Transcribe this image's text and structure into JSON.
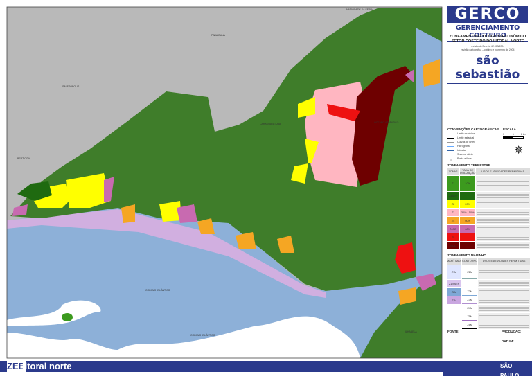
{
  "header": {
    "logo": "GERCO",
    "subtitle": "GERENCIAMENTO COSTEIRO",
    "title1": "ZONEAMENTO ECOLÓGICO-ECONÔMICO",
    "title2": "SETOR COSTEIRO DO LITORAL NORTE",
    "note1": "revisão do Decreto 62.913/2004",
    "note2": "revisão cartográfica – outubro e novembro de 2004",
    "city": "são sebastião"
  },
  "conventions": {
    "title": "CONVENÇÕES CARTOGRÁFICAS",
    "items": [
      "Limite municipal",
      "Limite estadual",
      "Curvas de nível",
      "Hidrografia",
      "Isóbata",
      "Sistema viário",
      "Ponta e ilhas"
    ]
  },
  "scale": {
    "title": "ESCALA",
    "ticks": [
      "0",
      "1",
      "2 km"
    ]
  },
  "terrestrial": {
    "title": "ZONEAMENTO TERRESTRE",
    "headers": [
      "ZONAS",
      "TAXA DE UTILIZAÇÃO",
      "USOS E ATIVIDADES PERMITIDAS"
    ],
    "rows": [
      {
        "zone": "Z1",
        "rate": "10%",
        "color": "#3c9a1e"
      },
      {
        "zone": "Z1AEP",
        "rate": "",
        "color": "#1f6a10"
      },
      {
        "zone": "Z2",
        "rate": "20%",
        "color": "#ffff00"
      },
      {
        "zone": "Z3",
        "rate": "30% - 50%",
        "color": "#ffb6c1"
      },
      {
        "zone": "Z4",
        "rate": "60%",
        "color": "#f5a623"
      },
      {
        "zone": "Z4OD",
        "rate": "60%",
        "color": "#c86ab0"
      },
      {
        "zone": "Z5",
        "rate": "",
        "color": "#ee1111"
      },
      {
        "zone": "Z5OD",
        "rate": "",
        "color": "#6e0000"
      }
    ]
  },
  "marine": {
    "title": "ZONEAMENTO MARINHO",
    "headers": [
      "MARÍTIMAS",
      "CONTORNO",
      "USOS E ATIVIDADES PERMITIDAS"
    ],
    "rows": [
      {
        "zone": "Z1M",
        "contour": "Z1M",
        "color": "#dfe6ff",
        "line": "#8aa"
      },
      {
        "zone": "Z1MAEP",
        "contour": "",
        "color": "#d9c4ee",
        "line": ""
      },
      {
        "zone": "Z2M",
        "contour": "Z2M",
        "color": "#7ea8d6",
        "line": "#7ea8d6"
      },
      {
        "zone": "Z3M",
        "contour": "Z3M",
        "color": "#c9a6e0",
        "line": "#b08fd0"
      },
      {
        "zone": "",
        "contour": "Z4M",
        "color": "",
        "line": "#557"
      },
      {
        "zone": "",
        "contour": "Z5M",
        "color": "",
        "line": "#a070c0"
      },
      {
        "zone": "",
        "contour": "Z6M",
        "color": "",
        "line": "#000"
      }
    ]
  },
  "footer": {
    "fonte": "FONTE:",
    "producao": "PRODUÇÃO:",
    "datum": "DATUM:",
    "banner_zee": "ZEE",
    "banner_title": "litoral norte",
    "sp_logo": "SÃO PAULO"
  },
  "map_labels": {
    "paraibuna": "PARAIBUNA",
    "salesopolis": "SALESÓPOLIS",
    "bertioga": "BERTIOGA",
    "caraguatatuba": "CARAGUATATUBA",
    "ilhabela": "ILHABELA",
    "ocean1": "OCEANO ATLÂNTICO",
    "ocean2": "OCEANO ATLÂNTICO",
    "ocean3": "OCEANO ATLÂNTICO",
    "natividade": "NATIVIDADE DA SERRA"
  }
}
